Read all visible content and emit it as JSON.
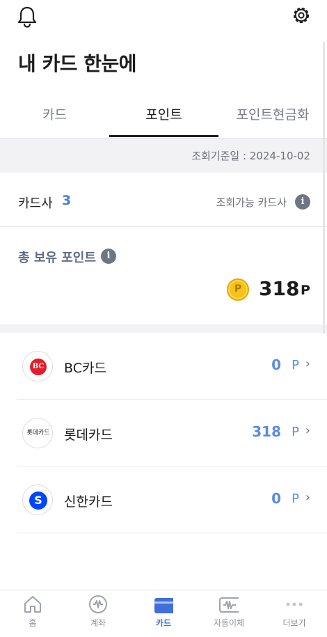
{
  "header": {
    "notifications_icon": "bell-icon",
    "settings_icon": "gear-icon"
  },
  "page": {
    "title": "내 카드 한눈에"
  },
  "tabs": [
    {
      "label": "카드",
      "active": false
    },
    {
      "label": "포인트",
      "active": true
    },
    {
      "label": "포인트현금화",
      "active": false
    }
  ],
  "query_date": "조회기준일 : 2024-10-02",
  "card_companies": {
    "label": "카드사",
    "count": "3",
    "available_label": "조회가능 카드사",
    "info_icon": "info-icon"
  },
  "total_points": {
    "label": "총 보유 포인트",
    "coin_symbol": "P",
    "value": "318",
    "unit": "P"
  },
  "cards": [
    {
      "name": "BC카드",
      "points": "0",
      "unit": "P",
      "logo_text": "BC",
      "logo_icon": "bc-card-logo-icon"
    },
    {
      "name": "롯데카드",
      "points": "318",
      "unit": "P",
      "logo_text": "롯데카드",
      "logo_icon": "lotte-card-logo-icon"
    },
    {
      "name": "신한카드",
      "points": "0",
      "unit": "P",
      "logo_text": "S",
      "logo_icon": "shinhan-card-logo-icon"
    }
  ],
  "bottom_nav": [
    {
      "label": "홈",
      "icon": "home-icon",
      "active": false
    },
    {
      "label": "계좌",
      "icon": "account-icon",
      "active": false
    },
    {
      "label": "카드",
      "icon": "card-icon",
      "active": true
    },
    {
      "label": "자동이체",
      "icon": "auto-transfer-icon",
      "active": false
    },
    {
      "label": "더보기",
      "icon": "more-icon",
      "active": false
    }
  ],
  "colors": {
    "accent": "#4a7bd8",
    "points_blue": "#5b8be0",
    "coin": "#f6c21c",
    "bc_red": "#e01e2b",
    "shinhan_blue": "#0046ff"
  }
}
